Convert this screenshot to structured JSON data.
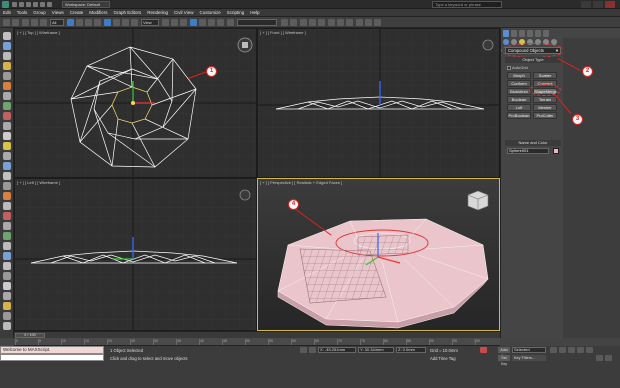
{
  "titlebar": {
    "workspace": "Workspace: Default",
    "search": "Type a keyword or phrase"
  },
  "menu": [
    "Edit",
    "Tools",
    "Group",
    "Views",
    "Create",
    "Modifiers",
    "Graph Editors",
    "Rendering",
    "Civil View",
    "Customize",
    "Scripting",
    "Help"
  ],
  "toolbar": {
    "view_dropdown": "View",
    "selection_set": ""
  },
  "viewports": {
    "top": "[ + ] [ Top ] [ Wireframe ]",
    "front": "[ + ] [ Front ] [ Wireframe ]",
    "left": "[ + ] [ Left ] [ Wireframe ]",
    "perspective": "[ + ] [ Perspective ] [ Realistic + Edged Faces ]"
  },
  "command_panel": {
    "category_dropdown": "Compound Objects",
    "object_type_header": "Object Type",
    "autogrid": "AutoGrid",
    "buttons": [
      "Morph",
      "Scatter",
      "Conform",
      "Connect",
      "BlobMesh",
      "ShapeMerge",
      "Boolean",
      "Terrain",
      "Loft",
      "Mesher",
      "ProBoolean",
      "ProCutter"
    ],
    "name_header": "Name and Color",
    "object_name": "Sphere001",
    "swatch_color": "#f2b3c6"
  },
  "callouts": [
    "1",
    "2",
    "3",
    "4"
  ],
  "timeline": {
    "slider": "0 / 100",
    "ticks": [
      "0",
      "5",
      "10",
      "15",
      "20",
      "25",
      "30",
      "35",
      "40",
      "45",
      "50",
      "55",
      "60",
      "65",
      "70",
      "75",
      "80",
      "85",
      "90",
      "95",
      "100"
    ]
  },
  "status": {
    "maxscript": "Welcome to MAXScript.",
    "selected": "1 Object Selected",
    "prompt": "Click and drag to select and move objects",
    "x": "X: -45.251mm",
    "y": "Y: 30.344mm",
    "z": "Z: 0.0mm",
    "grid": "Grid = 10.0mm",
    "add_time_tag": "Add Time Tag",
    "auto_key": "Auto Key",
    "set_key": "Set Key",
    "selected_dropdown": "Selected",
    "key_filters": "Key Filters..."
  },
  "colors": {
    "accent": "#3b7dc9",
    "callout": "#dd2222",
    "mesh_selected": "#f2b3c6"
  }
}
